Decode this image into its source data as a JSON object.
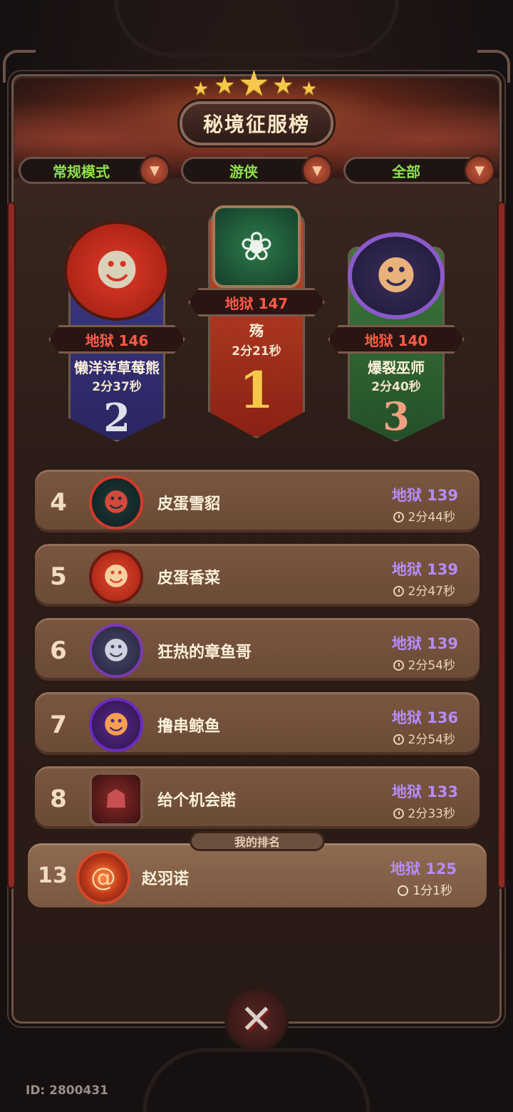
{
  "title": "秘境征服榜",
  "filters": [
    {
      "label": "常规模式"
    },
    {
      "label": "游侠"
    },
    {
      "label": "全部"
    }
  ],
  "podium": [
    {
      "rank": "1",
      "level": "地狱 147",
      "name": "殇",
      "time": "2分21秒"
    },
    {
      "rank": "2",
      "level": "地狱 146",
      "name": "懒洋洋草莓熊",
      "time": "2分37秒"
    },
    {
      "rank": "3",
      "level": "地狱 140",
      "name": "爆裂巫师",
      "time": "2分40秒"
    }
  ],
  "list": [
    {
      "rank": "4",
      "name": "皮蛋雪貂",
      "level": "地狱 139",
      "time": "2分44秒"
    },
    {
      "rank": "5",
      "name": "皮蛋香菜",
      "level": "地狱 139",
      "time": "2分47秒"
    },
    {
      "rank": "6",
      "name": "狂热的章鱼哥",
      "level": "地狱 139",
      "time": "2分54秒"
    },
    {
      "rank": "7",
      "name": "撸串鲸鱼",
      "level": "地狱 136",
      "time": "2分54秒"
    },
    {
      "rank": "8",
      "name": "给个机会諾",
      "level": "地狱 133",
      "time": "2分33秒"
    }
  ],
  "my_rank": {
    "tag": "我的排名",
    "rank": "13",
    "name": "赵羽诺",
    "level": "地狱 125",
    "time": "1分1秒"
  },
  "user_id": "ID: 2800431",
  "colors": {
    "hell_red": "#ff5a48",
    "hell_purple": "#b68cff",
    "filter_green": "#8ee04a",
    "gold": "#f6c84a"
  }
}
